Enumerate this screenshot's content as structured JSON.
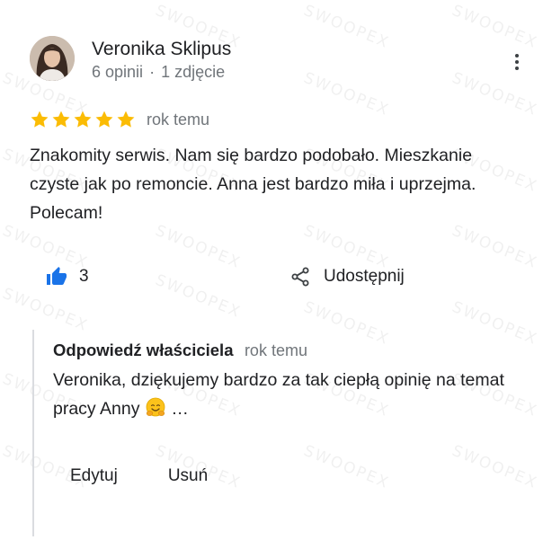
{
  "watermark": "SWOOPEX",
  "review": {
    "author_name": "Veronika Sklipus",
    "reviews_count": "6 opinii",
    "separator": "·",
    "photos_count": "1 zdjęcie",
    "rating": 5,
    "time": "rok temu",
    "text": "Znakomity serwis. Nam się bardzo podobało. Mieszkanie czyste jak po remoncie. Anna jest bardzo miła i uprzejma. Polecam!",
    "likes": "3",
    "share_label": "Udostępnij"
  },
  "owner_reply": {
    "title": "Odpowiedź właściciela",
    "time": "rok temu",
    "text": "Veronika, dziękujemy bardzo za tak ciepłą opinię na temat pracy Anny",
    "ellipsis": "…",
    "edit_label": "Edytuj",
    "delete_label": "Usuń"
  },
  "colors": {
    "star": "#fbbc04",
    "like_icon": "#1a73e8",
    "primary_text": "#202124",
    "secondary_text": "#70757a"
  },
  "icons": {
    "more": "more-vert-icon",
    "like": "thumb-up-icon",
    "share": "share-icon",
    "emoji": "hugging-face-emoji"
  }
}
